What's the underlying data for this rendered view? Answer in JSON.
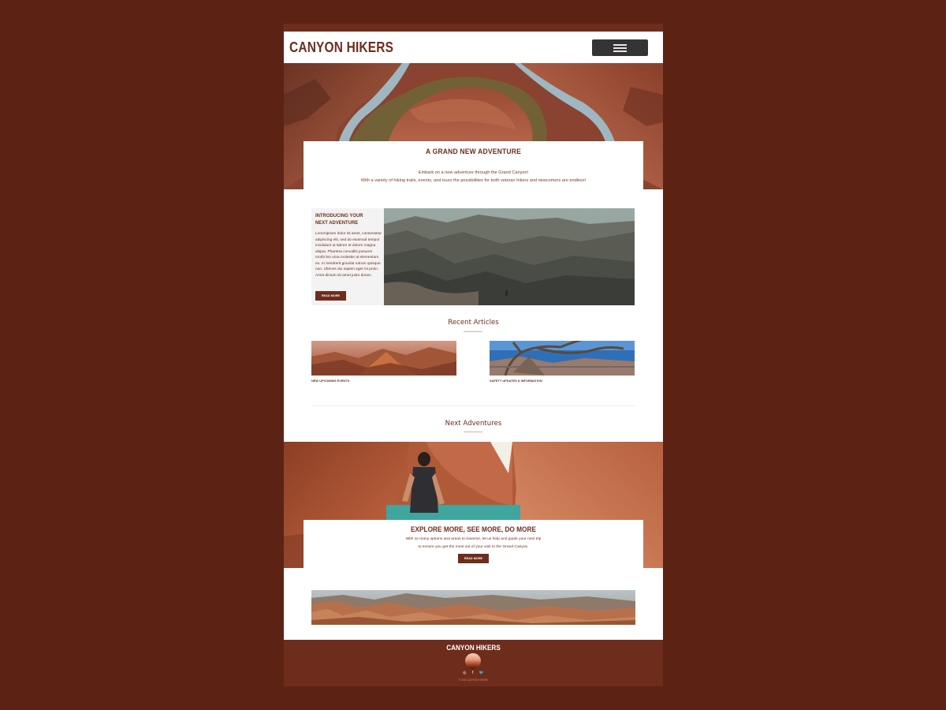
{
  "header": {
    "brand": "CANYON HIKERS",
    "menu_icon": "hamburger-menu-icon"
  },
  "hero": {
    "title": "A GRAND NEW ADVENTURE",
    "line1": "Embark on a new adventure through the Grand Canyon!",
    "line2": "With a variety of hiking trails, events, and tours the possibilities for both veteran hikers and newcomers are endless!"
  },
  "intro": {
    "title_line1": "INTRODUCING YOUR",
    "title_line2": "NEXT ADVENTURE",
    "body": "Loremipsum dolor sit amet, consectetur adipiscing elit, sed do eiusmod tempor incididunt ut labore et dolore magna aliqua. Pharetra convallis posuere morbi leo urna molestie at elementum eu. In hendrerit gravida rutrum quisque non. Ultrices dui sapien eget mi proin. Amet dictum sit amet justo donec.",
    "button": "READ MORE"
  },
  "recent_articles": {
    "title": "Recent Articles",
    "items": [
      {
        "caption": "NEW UPCOMING EVENTS"
      },
      {
        "caption": "SAFETY UPDATES & INFORMATION"
      }
    ]
  },
  "next_adventures": {
    "title": "Next Adventures",
    "card_title": "EXPLORE MORE, SEE MORE, DO MORE",
    "line1": "With so many options and areas to traverse, let us help and guide your next trip",
    "line2": "to ensure you get the most out of your visit to the Grand Canyon.",
    "button": "READ MORE"
  },
  "footer": {
    "brand": "CANYON HIKERS",
    "social": [
      "◎",
      "f",
      "🐦"
    ],
    "social_icons": [
      "instagram-icon",
      "facebook-icon",
      "twitter-icon"
    ],
    "copyright": "© 2021 CANYON HIKERS"
  },
  "colors": {
    "background": "#5c2314",
    "brand": "#6e2d1c",
    "menu_button": "#343434"
  }
}
